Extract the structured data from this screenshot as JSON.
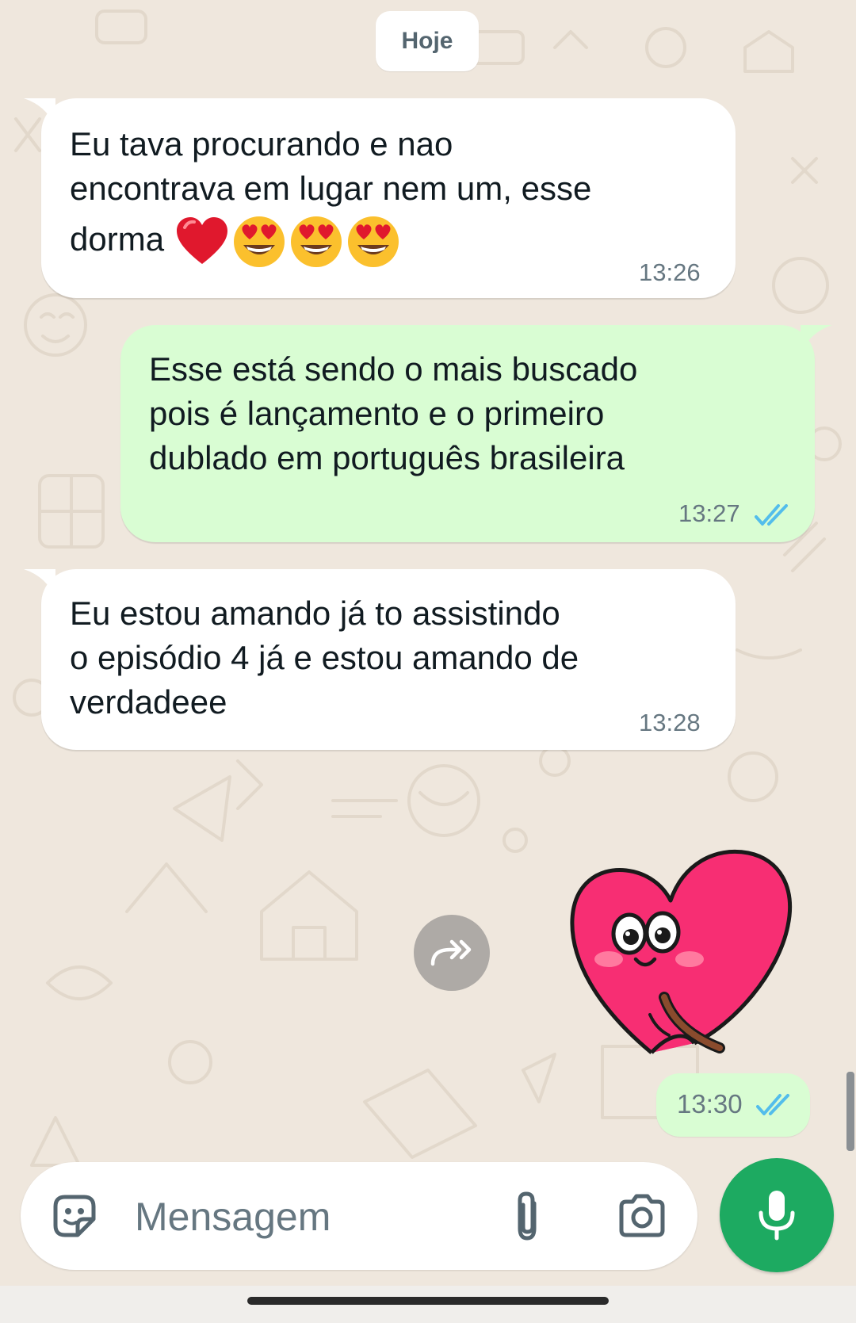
{
  "date_chip": {
    "label": "Hoje"
  },
  "messages": [
    {
      "direction": "incoming",
      "line1": "Eu tava procurando e nao",
      "line2": "encontrava em lugar nem um, esse",
      "line3": "dorma",
      "emojis": [
        "red-heart",
        "heart-eyes",
        "heart-eyes",
        "heart-eyes"
      ],
      "time": "13:26"
    },
    {
      "direction": "outgoing",
      "text": "Esse está sendo o mais buscado\npois é lançamento e o primeiro\ndublado em português brasileira",
      "time": "13:27",
      "status": "read"
    },
    {
      "direction": "incoming",
      "text": "Eu estou amando já to assistindo\no episódio 4 já e estou amando de\nverdadeee",
      "time": "13:28"
    }
  ],
  "sticker_message": {
    "direction": "outgoing",
    "sticker": "pink-heart-character",
    "time": "13:30",
    "status": "read"
  },
  "forward_button": {
    "icon": "forward-icon"
  },
  "composer": {
    "placeholder": "Mensagem",
    "icons": [
      "sticker-icon",
      "attach-icon",
      "camera-icon"
    ]
  },
  "mic_button": {
    "icon": "mic-icon"
  },
  "colors": {
    "incoming_bubble": "#ffffff",
    "outgoing_bubble": "#d9fdd3",
    "read_ticks": "#53bdeb",
    "mic_button": "#1daa61",
    "wallpaper": "#efe7dd"
  }
}
